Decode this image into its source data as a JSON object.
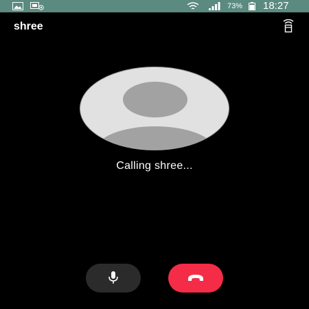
{
  "status_bar": {
    "battery_percent": "73%",
    "time": "18:27",
    "icons": [
      "gallery-icon",
      "cast-icon",
      "wifi-icon",
      "signal-icon",
      "battery-icon"
    ],
    "background_color": "#5a8a80"
  },
  "call": {
    "contact_name": "shree",
    "status": "Calling shree..."
  },
  "controls": {
    "audio_route_icon": "speaker-audio-route-icon",
    "mute_icon": "microphone-icon",
    "end_call_icon": "hang-up-icon",
    "end_call_color": "#f42c48",
    "mute_color": "#2b2b2b"
  }
}
